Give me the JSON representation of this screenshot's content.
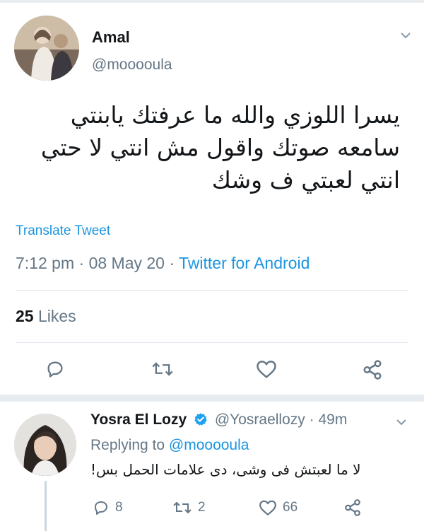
{
  "main_tweet": {
    "author_name": "Amal",
    "author_handle": "@mooooula",
    "text": "يسرا اللوزي والله ما عرفتك يابنتي سامعه صوتك واقول مش انتي لا حتي انتي لعبتي ف وشك",
    "translate_label": "Translate Tweet",
    "time": "7:12 pm",
    "date": "08 May 20",
    "source": "Twitter for Android",
    "likes_count": "25",
    "likes_label": "Likes"
  },
  "reply_tweet": {
    "author_name": "Yosra El Lozy",
    "author_handle": "@Yosraellozy",
    "age": "49m",
    "replying_prefix": "Replying to",
    "replying_to": "@mooooula",
    "text": "لا ما لعبتش فى وشى، دى علامات الحمل بس!",
    "reply_count": "8",
    "retweet_count": "2",
    "like_count": "66"
  },
  "icons": {
    "reply": "reply-icon",
    "retweet": "retweet-icon",
    "like": "heart-icon",
    "share": "share-icon",
    "more": "chevron-down-icon",
    "verified": "verified-badge-icon"
  },
  "colors": {
    "link": "#1b95e0",
    "secondary_text": "#657786",
    "primary_text": "#14171a",
    "verified": "#1da1f2"
  }
}
